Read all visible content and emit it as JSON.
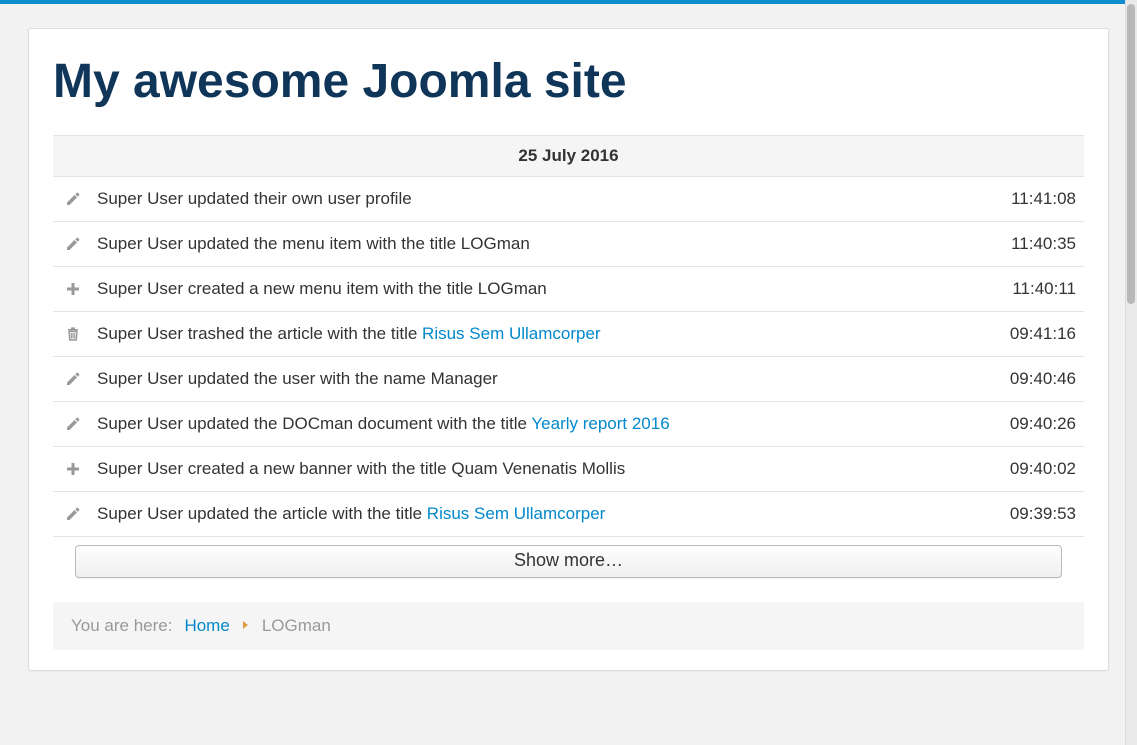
{
  "site_title": "My awesome Joomla site",
  "date_header": "25 July 2016",
  "entries": [
    {
      "icon": "pencil",
      "time": "11:41:08",
      "segments": [
        {
          "t": "text",
          "v": "Super User updated their own user profile"
        }
      ]
    },
    {
      "icon": "pencil",
      "time": "11:40:35",
      "segments": [
        {
          "t": "text",
          "v": "Super User updated the menu item with the title LOGman"
        }
      ]
    },
    {
      "icon": "plus",
      "time": "11:40:11",
      "segments": [
        {
          "t": "text",
          "v": "Super User created a new menu item with the title LOGman"
        }
      ]
    },
    {
      "icon": "trash",
      "time": "09:41:16",
      "segments": [
        {
          "t": "text",
          "v": "Super User trashed the article with the title "
        },
        {
          "t": "link",
          "v": "Risus Sem Ullamcorper"
        }
      ]
    },
    {
      "icon": "pencil",
      "time": "09:40:46",
      "segments": [
        {
          "t": "text",
          "v": "Super User updated the user with the name Manager"
        }
      ]
    },
    {
      "icon": "pencil",
      "time": "09:40:26",
      "segments": [
        {
          "t": "text",
          "v": "Super User updated the DOCman document with the title "
        },
        {
          "t": "link",
          "v": "Yearly report 2016"
        }
      ]
    },
    {
      "icon": "plus",
      "time": "09:40:02",
      "segments": [
        {
          "t": "text",
          "v": "Super User created a new banner with the title Quam Venenatis Mollis"
        }
      ]
    },
    {
      "icon": "pencil",
      "time": "09:39:53",
      "segments": [
        {
          "t": "text",
          "v": "Super User updated the article with the title "
        },
        {
          "t": "link",
          "v": "Risus Sem Ullamcorper"
        }
      ]
    }
  ],
  "show_more_label": "Show more…",
  "breadcrumb": {
    "prefix": "You are here:",
    "home_label": "Home",
    "current": "LOGman"
  },
  "icons": {
    "pencil_name": "pencil-icon",
    "plus_name": "plus-icon",
    "trash_name": "trash-icon"
  }
}
